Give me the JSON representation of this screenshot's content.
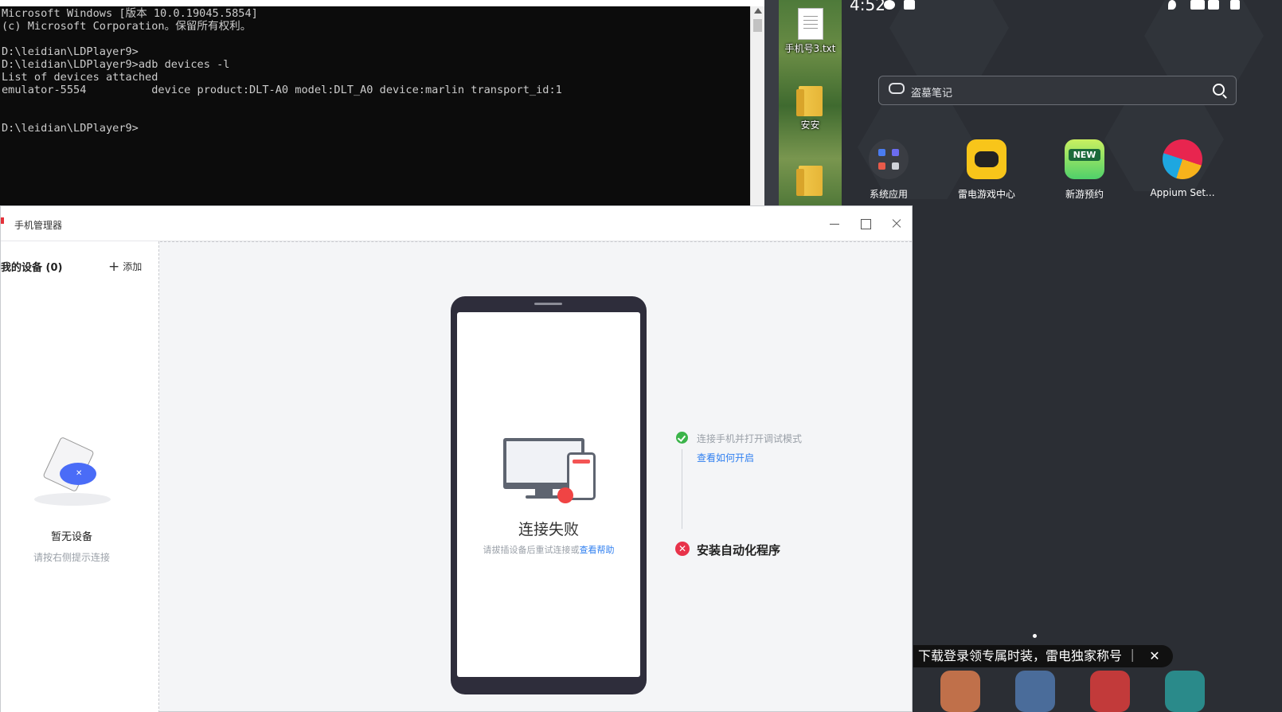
{
  "terminal": {
    "lines": [
      "Microsoft Windows [版本 10.0.19045.5854]",
      "(c) Microsoft Corporation。保留所有权利。",
      "",
      "D:\\leidian\\LDPlayer9>",
      "D:\\leidian\\LDPlayer9>adb devices -l",
      "List of devices attached",
      "emulator-5554          device product:DLT-A0 model:DLT_A0 device:marlin transport_id:1",
      "",
      "",
      "D:\\leidian\\LDPlayer9>"
    ]
  },
  "desktop": {
    "items": [
      {
        "label": "手机号3.txt",
        "icon": "text-file-icon"
      },
      {
        "label": "安安",
        "icon": "folder-icon"
      },
      {
        "label": "",
        "icon": "folder-icon"
      }
    ]
  },
  "emulator": {
    "time": "4:52",
    "search_placeholder": "盗墓笔记",
    "apps": [
      {
        "label": "系统应用",
        "icon": "system-apps-icon"
      },
      {
        "label": "雷电游戏中心",
        "icon": "game-center-icon"
      },
      {
        "label": "新游预约",
        "icon": "new-games-icon"
      },
      {
        "label": "Appium Set...",
        "icon": "appium-settings-icon"
      }
    ],
    "new_badge": "NEW",
    "banner_text": "下载登录领专属时装，雷电独家称号 ｜",
    "banner_close": "✕"
  },
  "phone_manager": {
    "window_title": "手机管理器",
    "my_devices": "我的设备 (0)",
    "add_label": "添加",
    "empty_title": "暂无设备",
    "empty_hint": "请按右侧提示连接",
    "connect_failed": "连接失败",
    "retry_hint": "请拔插设备后重试连接或",
    "help_link": "查看帮助",
    "step1": "连接手机并打开调试模式",
    "step1_link": "查看如何开启",
    "step2": "安装自动化程序",
    "step2_status_mark": "✕"
  },
  "colors": {
    "accent": "#2f7ff0",
    "success": "#3bb44a",
    "error": "#e8334a",
    "terminal_bg": "#0c0c0c",
    "emulator_bg": "#2b2e34"
  }
}
